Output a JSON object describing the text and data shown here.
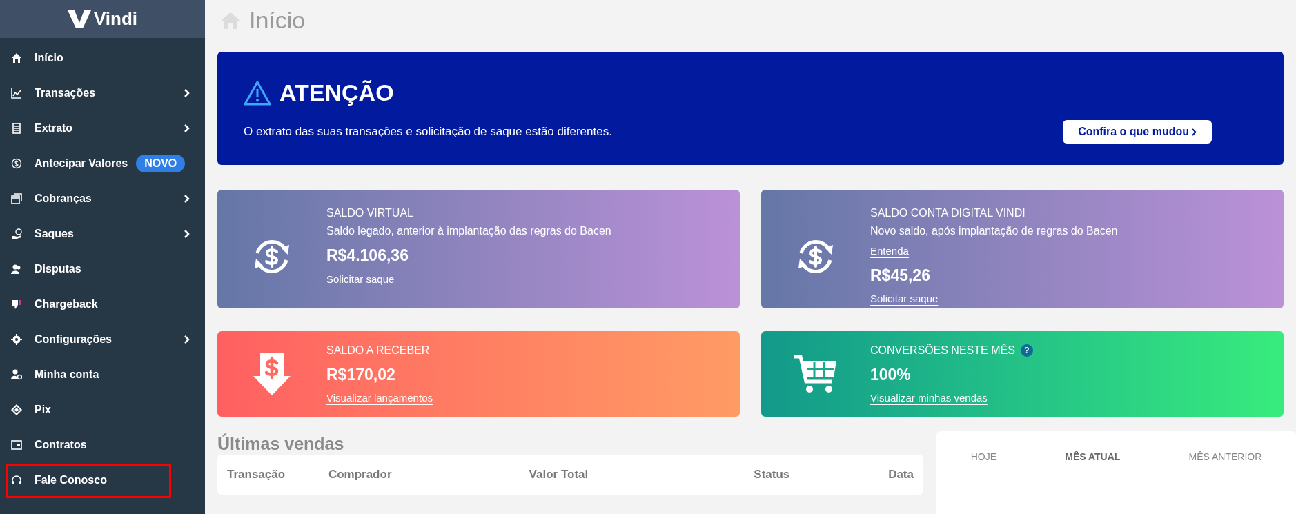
{
  "sidebar": {
    "logo": "Vindi",
    "items": [
      {
        "label": "Início",
        "has_submenu": false,
        "highlighted": false
      },
      {
        "label": "Transações",
        "has_submenu": true,
        "highlighted": false
      },
      {
        "label": "Extrato",
        "has_submenu": true,
        "highlighted": false
      },
      {
        "label": "Antecipar Valores",
        "has_submenu": false,
        "badge": "NOVO",
        "highlighted": false
      },
      {
        "label": "Cobranças",
        "has_submenu": true,
        "highlighted": false
      },
      {
        "label": "Saques",
        "has_submenu": true,
        "highlighted": false
      },
      {
        "label": "Disputas",
        "has_submenu": false,
        "highlighted": false
      },
      {
        "label": "Chargeback",
        "has_submenu": false,
        "highlighted": false
      },
      {
        "label": "Configurações",
        "has_submenu": true,
        "highlighted": false
      },
      {
        "label": "Minha conta",
        "has_submenu": false,
        "highlighted": false
      },
      {
        "label": "Pix",
        "has_submenu": false,
        "highlighted": false
      },
      {
        "label": "Contratos",
        "has_submenu": false,
        "highlighted": false
      },
      {
        "label": "Fale Conosco",
        "has_submenu": false,
        "highlighted": true
      }
    ]
  },
  "page_title": "Início",
  "alert": {
    "title": "ATENÇÃO",
    "message": "O extrato das suas transações e solicitação de saque estão diferentes.",
    "button": "Confira o que mudou"
  },
  "cards": [
    {
      "kind": "virtual",
      "title": "SALDO VIRTUAL",
      "subtitle": "Saldo legado, anterior à implantação das regras do Bacen",
      "value": "R$4.106,36",
      "link": "Solicitar saque"
    },
    {
      "kind": "virtual",
      "title": "SALDO CONTA DIGITAL VINDI",
      "subtitle": "Novo saldo, após implantação de regras do Bacen",
      "extra_link": "Entenda",
      "value": "R$45,26",
      "link": "Solicitar saque"
    },
    {
      "kind": "receive",
      "title": "SALDO A RECEBER",
      "value": "R$170,02",
      "link": "Visualizar lançamentos"
    },
    {
      "kind": "conversion",
      "title": "CONVERSÕES NESTE MÊS",
      "help": "?",
      "value": "100%",
      "link": "Visualizar minhas vendas"
    }
  ],
  "sales": {
    "title": "Últimas vendas",
    "columns": [
      "Transação",
      "Comprador",
      "Valor Total",
      "Status",
      "Data"
    ]
  },
  "period_tabs": [
    {
      "label": "HOJE",
      "selected": false
    },
    {
      "label": "MÊS ATUAL",
      "selected": true
    },
    {
      "label": "MÊS ANTERIOR",
      "selected": false
    }
  ]
}
